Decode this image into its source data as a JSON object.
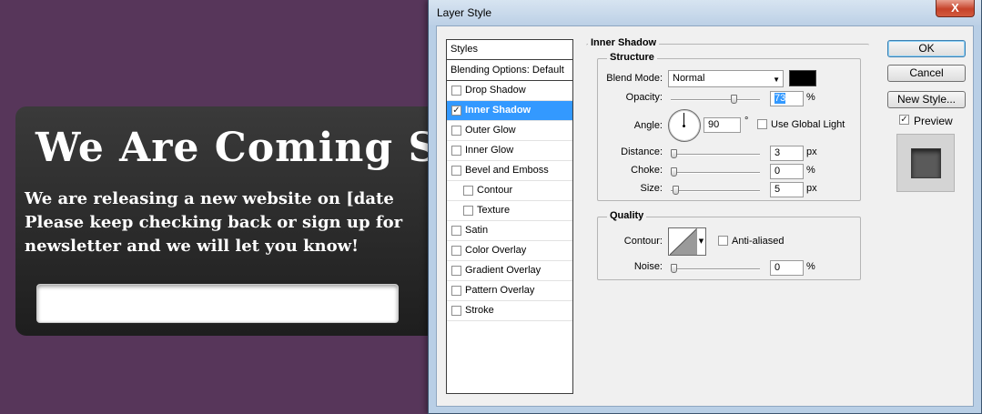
{
  "canvas": {
    "title": "We Are Coming S",
    "text_lines": [
      "We are releasing a new website on [date",
      "Please keep checking back or sign up for",
      "newsletter and we will let you know!"
    ]
  },
  "dialog": {
    "title": "Layer Style",
    "close_glyph": "X",
    "styles_list": {
      "header": "Styles",
      "blending": "Blending Options: Default",
      "items": [
        {
          "label": "Drop Shadow",
          "checked": false,
          "indent": false,
          "selected": false
        },
        {
          "label": "Inner Shadow",
          "checked": true,
          "indent": false,
          "selected": true
        },
        {
          "label": "Outer Glow",
          "checked": false,
          "indent": false,
          "selected": false
        },
        {
          "label": "Inner Glow",
          "checked": false,
          "indent": false,
          "selected": false
        },
        {
          "label": "Bevel and Emboss",
          "checked": false,
          "indent": false,
          "selected": false
        },
        {
          "label": "Contour",
          "checked": false,
          "indent": true,
          "selected": false
        },
        {
          "label": "Texture",
          "checked": false,
          "indent": true,
          "selected": false
        },
        {
          "label": "Satin",
          "checked": false,
          "indent": false,
          "selected": false
        },
        {
          "label": "Color Overlay",
          "checked": false,
          "indent": false,
          "selected": false
        },
        {
          "label": "Gradient Overlay",
          "checked": false,
          "indent": false,
          "selected": false
        },
        {
          "label": "Pattern Overlay",
          "checked": false,
          "indent": false,
          "selected": false
        },
        {
          "label": "Stroke",
          "checked": false,
          "indent": false,
          "selected": false
        }
      ]
    },
    "panel_title": "Inner Shadow",
    "structure": {
      "title": "Structure",
      "blend_mode_label": "Blend Mode:",
      "blend_mode_value": "Normal",
      "shadow_color": "#000000",
      "opacity_label": "Opacity:",
      "opacity_value": "73",
      "opacity_unit": "%",
      "angle_label": "Angle:",
      "angle_value": "90",
      "angle_unit": "°",
      "global_light_label": "Use Global Light",
      "distance_label": "Distance:",
      "distance_value": "3",
      "distance_unit": "px",
      "choke_label": "Choke:",
      "choke_value": "0",
      "choke_unit": "%",
      "size_label": "Size:",
      "size_value": "5",
      "size_unit": "px"
    },
    "quality": {
      "title": "Quality",
      "contour_label": "Contour:",
      "anti_aliased_label": "Anti-aliased",
      "noise_label": "Noise:",
      "noise_value": "0",
      "noise_unit": "%"
    },
    "buttons": {
      "ok": "OK",
      "cancel": "Cancel",
      "new_style": "New Style...",
      "preview_label": "Preview"
    },
    "sliders": {
      "opacity": 0.73,
      "distance": 0.0,
      "choke": 0.0,
      "size": 0.02,
      "noise": 0.0
    },
    "colors": {
      "selection": "#3399ff",
      "background": "#57365a"
    }
  }
}
